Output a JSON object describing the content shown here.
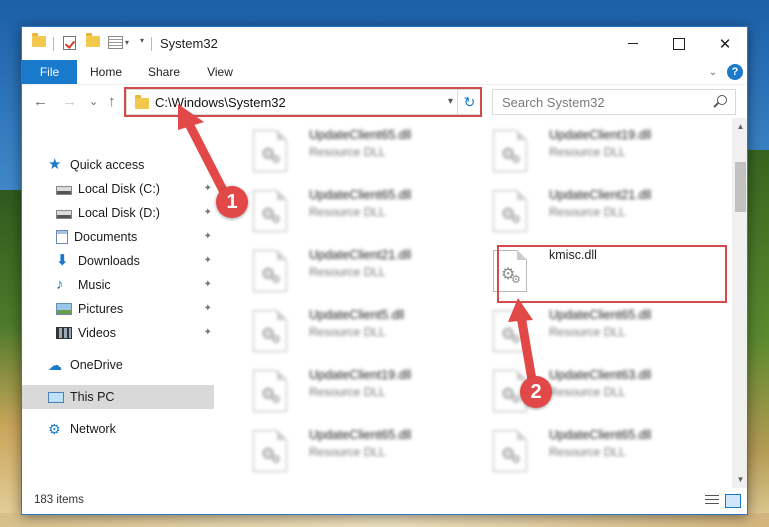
{
  "window": {
    "title": "System32",
    "close_glyph": "✕"
  },
  "ribbon": {
    "tabs": [
      "File",
      "Home",
      "Share",
      "View"
    ],
    "help_glyph": "?",
    "collapse_glyph": "⌄"
  },
  "nav": {
    "back_glyph": "←",
    "forward_glyph": "→",
    "recent_glyph": "⌄",
    "up_glyph": "↑",
    "address": "C:\\Windows\\System32",
    "refresh_glyph": "↻",
    "search_placeholder": "Search System32"
  },
  "sidebar": {
    "items": [
      {
        "label": "Quick access",
        "icon": "star-icon",
        "glyph": "★",
        "pinned": false
      },
      {
        "label": "Local Disk (C:)",
        "icon": "drive-icon",
        "glyph": "",
        "pinned": true
      },
      {
        "label": "Local Disk (D:)",
        "icon": "drive-icon",
        "glyph": "",
        "pinned": true
      },
      {
        "label": "Documents",
        "icon": "documents-icon",
        "glyph": "",
        "pinned": true
      },
      {
        "label": "Downloads",
        "icon": "download-icon",
        "glyph": "⬇",
        "pinned": true
      },
      {
        "label": "Music",
        "icon": "music-icon",
        "glyph": "♪",
        "pinned": true
      },
      {
        "label": "Pictures",
        "icon": "pictures-icon",
        "glyph": "",
        "pinned": true
      },
      {
        "label": "Videos",
        "icon": "video-icon",
        "glyph": "",
        "pinned": true
      },
      {
        "label": "OneDrive",
        "icon": "cloud-icon",
        "glyph": "☁",
        "pinned": false
      },
      {
        "label": "This PC",
        "icon": "pc-icon",
        "glyph": "",
        "pinned": false
      },
      {
        "label": "Network",
        "icon": "network-icon",
        "glyph": "⚙",
        "pinned": false
      }
    ],
    "pin_glyph": "📌"
  },
  "files": [
    {
      "name": "UpdateClient65.dll",
      "desc": "Resource DLL"
    },
    {
      "name": "UpdateClient19.dll",
      "desc": "Resource DLL"
    },
    {
      "name": "UpdateClient65.dll",
      "desc": "Resource DLL"
    },
    {
      "name": "UpdateClient21.dll",
      "desc": "Resource DLL"
    },
    {
      "name": "UpdateClient21.dll",
      "desc": "Resource DLL"
    },
    {
      "name": "kmisc.dll",
      "desc": ""
    },
    {
      "name": "UpdateClient5.dll",
      "desc": "Resource DLL"
    },
    {
      "name": "UpdateClient65.dll",
      "desc": "Resource DLL"
    },
    {
      "name": "UpdateClient19.dll",
      "desc": "Resource DLL"
    },
    {
      "name": "UpdateClient63.dll",
      "desc": "Resource DLL"
    },
    {
      "name": "UpdateClient65.dll",
      "desc": "Resource DLL"
    },
    {
      "name": "UpdateClient65.dll",
      "desc": "Resource DLL"
    }
  ],
  "status": {
    "item_count": "183 items"
  },
  "annotations": {
    "step1": "1",
    "step2": "2",
    "accent": "#e24848"
  },
  "colors": {
    "accent_blue": "#1979ca",
    "highlight_red": "#d44b4b"
  }
}
